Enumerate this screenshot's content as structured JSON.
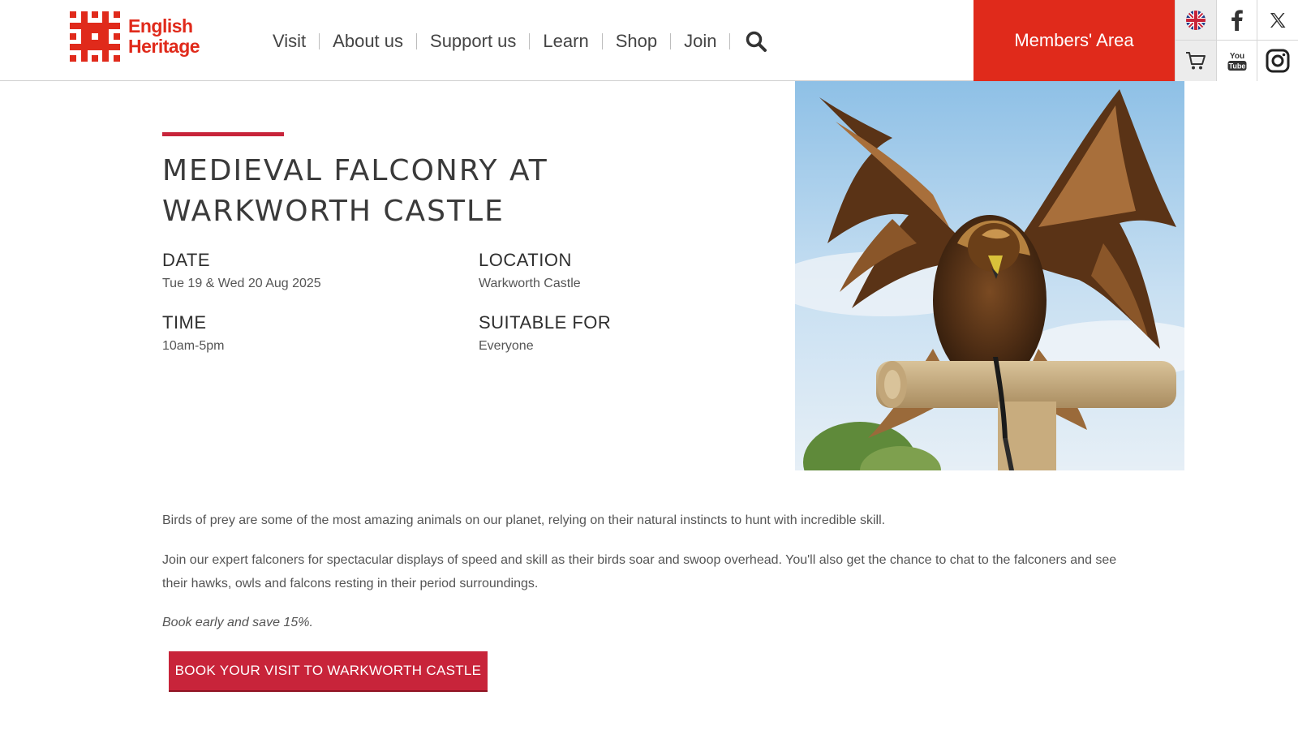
{
  "brand": {
    "name_line1": "English",
    "name_line2": "Heritage",
    "color": "#e02a1b"
  },
  "nav": {
    "items": [
      {
        "label": "Visit"
      },
      {
        "label": "About us"
      },
      {
        "label": "Support us"
      },
      {
        "label": "Learn"
      },
      {
        "label": "Shop"
      },
      {
        "label": "Join"
      }
    ],
    "search_icon": "search-icon"
  },
  "members_area": {
    "label": "Members' Area",
    "color": "#e02a1b"
  },
  "utility_icons": [
    "uk-flag-icon",
    "facebook-icon",
    "x-icon",
    "cart-icon",
    "youtube-icon",
    "instagram-icon"
  ],
  "event": {
    "title": "MEDIEVAL FALCONRY AT WARKWORTH CASTLE",
    "date_label": "DATE",
    "date_value": "Tue 19 & Wed 20 Aug 2025",
    "location_label": "LOCATION",
    "location_value": "Warkworth Castle",
    "time_label": "TIME",
    "time_value": "10am-5pm",
    "suitable_label": "SUITABLE FOR",
    "suitable_value": "Everyone",
    "accent_color": "#c8243a"
  },
  "body": {
    "p1": "Birds of prey are some of the most amazing animals on our planet, relying on their natural instincts to hunt with incredible skill.",
    "p2": "Join our expert falconers for spectacular displays of speed and skill as their birds soar and swoop overhead. You'll also get the chance to chat to the falconers and see their hawks, owls and falcons resting in their period surroundings.",
    "p3": "Book early and save 15%."
  },
  "cta": {
    "label": "BOOK YOUR VISIT TO WARKWORTH CASTLE"
  }
}
